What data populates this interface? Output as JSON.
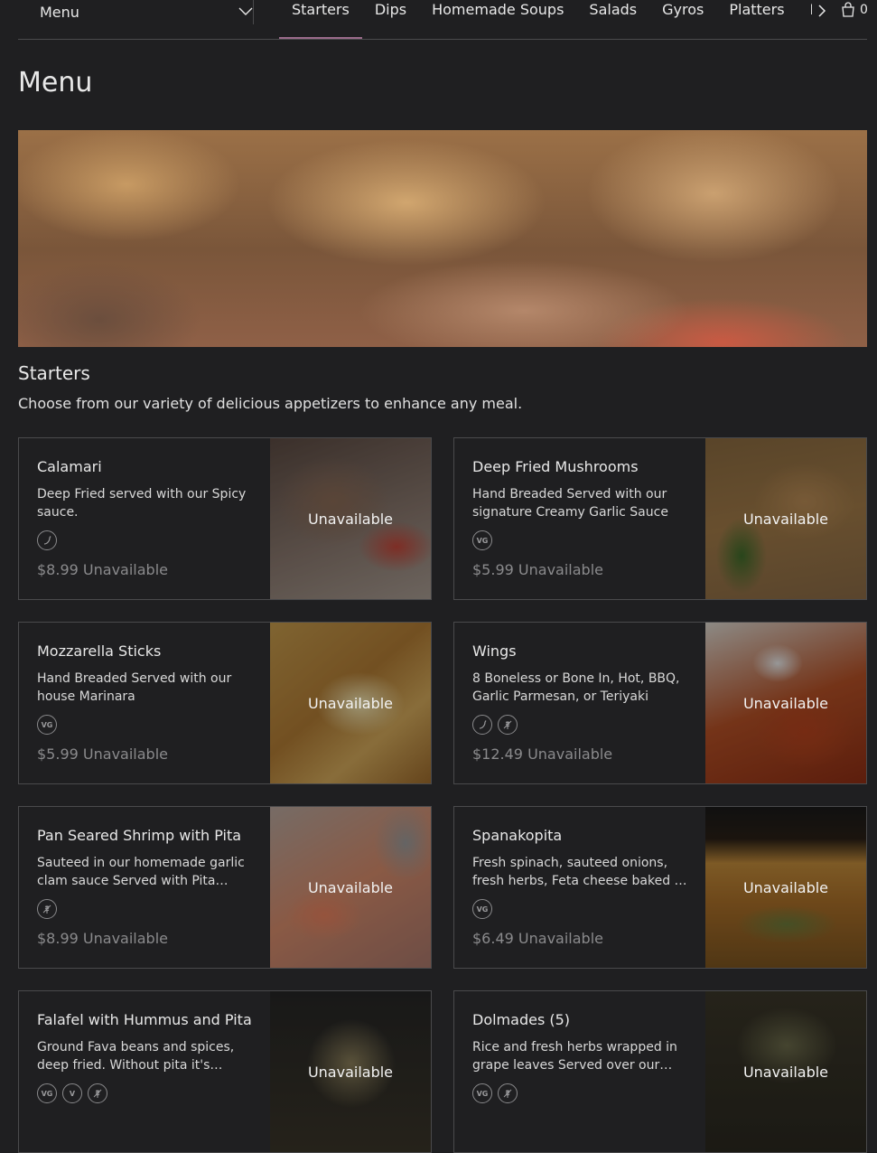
{
  "header": {
    "menu_select_label": "Menu",
    "tabs": [
      {
        "label": "Starters",
        "active": true
      },
      {
        "label": "Dips"
      },
      {
        "label": "Homemade Soups"
      },
      {
        "label": "Salads"
      },
      {
        "label": "Gyros"
      },
      {
        "label": "Platters"
      },
      {
        "label": "Pa"
      }
    ],
    "cart_count": "0",
    "accent_color": "#9a6b8a"
  },
  "page_title": "Menu",
  "section": {
    "title": "Starters",
    "description": "Choose from our variety of delicious appetizers to enhance any meal."
  },
  "items": [
    {
      "name": "Calamari",
      "description": "Deep Fried served with our Spicy sauce.",
      "badges": [
        "spicy-icon"
      ],
      "price": "$8.99",
      "status": "Unavailable",
      "image_status": "Unavailable"
    },
    {
      "name": "Deep Fried Mushrooms",
      "description": "Hand Breaded Served with our signature Creamy Garlic Sauce",
      "badges": [
        "VG"
      ],
      "price": "$5.99",
      "status": "Unavailable",
      "image_status": "Unavailable"
    },
    {
      "name": "Mozzarella Sticks",
      "description": "Hand Breaded Served with our house Marinara",
      "badges": [
        "VG"
      ],
      "price": "$5.99",
      "status": "Unavailable",
      "image_status": "Unavailable"
    },
    {
      "name": "Wings",
      "description": "8 Boneless or Bone In, Hot, BBQ, Garlic Parmesan, or Teriyaki",
      "badges": [
        "spicy-icon",
        "gluten-free-icon"
      ],
      "price": "$12.49",
      "status": "Unavailable",
      "image_status": "Unavailable"
    },
    {
      "name": "Pan Seared Shrimp with Pita",
      "description": "Sauteed in our homemade garlic clam sauce Served with Pita bread",
      "badges": [
        "gluten-free-icon"
      ],
      "price": "$8.99",
      "status": "Unavailable",
      "image_status": "Unavailable"
    },
    {
      "name": "Spanakopita",
      "description": "Fresh spinach, sauteed onions, fresh herbs, Feta cheese baked in phyllo dough",
      "badges": [
        "VG"
      ],
      "price": "$6.49",
      "status": "Unavailable",
      "image_status": "Unavailable"
    },
    {
      "name": "Falafel with Hummus and Pita",
      "description": "Ground Fava beans and spices, deep fried. Without pita it's gluten free",
      "badges": [
        "VG",
        "V",
        "gluten-free-icon"
      ],
      "price": "",
      "status": "",
      "image_status": "Unavailable"
    },
    {
      "name": "Dolmades (5)",
      "description": "Rice and fresh herbs wrapped in grape leaves Served over our fresh tzatziki",
      "badges": [
        "VG",
        "gluten-free-icon"
      ],
      "price": "",
      "status": "",
      "image_status": "Unavailable"
    }
  ]
}
